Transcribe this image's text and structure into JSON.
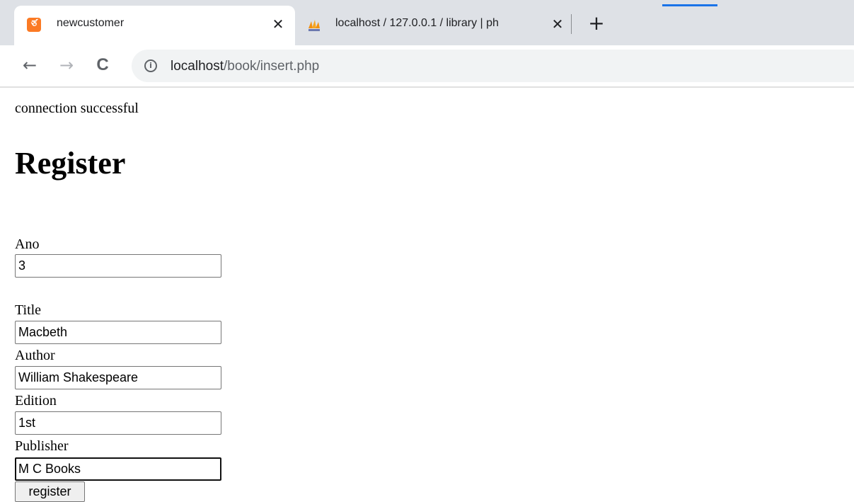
{
  "browser": {
    "tabs": [
      {
        "title": "newcustomer",
        "favicon": "xampp-icon",
        "active": true,
        "close_glyph": "✕"
      },
      {
        "title": "localhost / 127.0.0.1 / library | ph",
        "favicon": "phpmyadmin-icon",
        "active": false,
        "close_glyph": "✕"
      }
    ],
    "new_tab_glyph": "+",
    "nav": {
      "back_glyph": "←",
      "forward_glyph": "→",
      "reload_glyph": "C"
    },
    "address_bar": {
      "host": "localhost",
      "path": "/book/insert.php",
      "info_glyph": "i"
    }
  },
  "page": {
    "status_text": "connection successful",
    "heading": "Register",
    "form": {
      "fields": [
        {
          "label": "Ano",
          "value": "3"
        },
        {
          "label": "Title",
          "value": "Macbeth"
        },
        {
          "label": "Author",
          "value": "William Shakespeare"
        },
        {
          "label": "Edition",
          "value": "1st"
        },
        {
          "label": "Publisher",
          "value": "M C Books",
          "focused": true
        }
      ],
      "submit_label": "register"
    }
  },
  "colors": {
    "tabstrip_bg": "#dee1e6",
    "omnibox_bg": "#f1f3f4",
    "xampp_orange": "#fb7a24",
    "accent_blue": "#1a73e8"
  }
}
